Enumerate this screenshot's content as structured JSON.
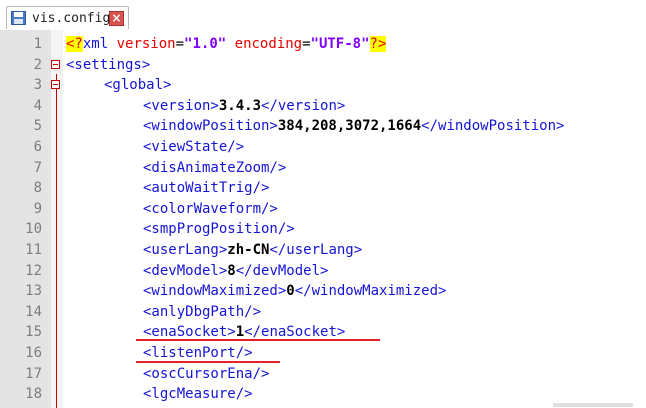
{
  "tab": {
    "filename": "vis.config",
    "icon": "save-icon",
    "close_icon": "close-icon",
    "close_glyph": "×"
  },
  "editor": {
    "lines": [
      {
        "n": "1"
      },
      {
        "n": "2",
        "tag": "<settings>"
      },
      {
        "n": "3",
        "tag": "<global>"
      },
      {
        "n": "4",
        "open": "<version>",
        "value": "3.4.3",
        "close": "</version>"
      },
      {
        "n": "5",
        "open": "<windowPosition>",
        "value": "384,208,3072,1664",
        "close": "</windowPosition>"
      },
      {
        "n": "6",
        "tag": "<viewState/>"
      },
      {
        "n": "7",
        "tag": "<disAnimateZoom/>"
      },
      {
        "n": "8",
        "tag": "<autoWaitTrig/>"
      },
      {
        "n": "9",
        "tag": "<colorWaveform/>"
      },
      {
        "n": "10",
        "tag": "<smpProgPosition/>"
      },
      {
        "n": "11",
        "open": "<userLang>",
        "value": "zh-CN",
        "close": "</userLang>"
      },
      {
        "n": "12",
        "open": "<devModel>",
        "value": "8",
        "close": "</devModel>"
      },
      {
        "n": "13",
        "open": "<windowMaximized>",
        "value": "0",
        "close": "</windowMaximized>"
      },
      {
        "n": "14",
        "tag": "<anlyDbgPath/>"
      },
      {
        "n": "15",
        "open": "<enaSocket>",
        "value": "1",
        "close": "</enaSocket>"
      },
      {
        "n": "16",
        "tag": "<listenPort/>"
      },
      {
        "n": "17",
        "tag": "<oscCursorEna/>"
      },
      {
        "n": "18",
        "tag": "<lgcMeasure/>"
      }
    ],
    "decl": {
      "open": "<?",
      "name": "xml",
      "attr1": "version",
      "eq": "=",
      "val1": "\"1.0\"",
      "attr2": "encoding",
      "val2": "\"UTF-8\"",
      "close": "?>"
    }
  },
  "colors": {
    "tag": "#1414d6",
    "attr": "#e60000",
    "string": "#8000ff",
    "highlight": "#ffff00",
    "annotation": "#e8202a"
  }
}
